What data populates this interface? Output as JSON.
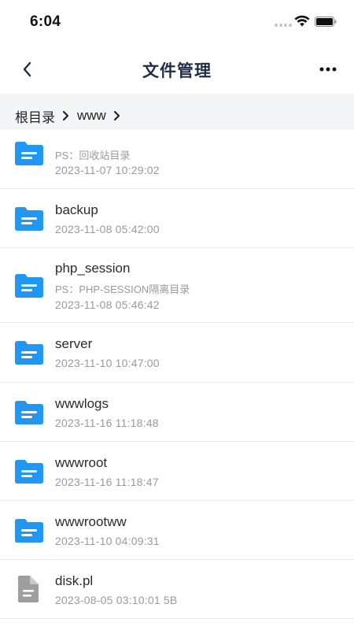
{
  "status_bar": {
    "time": "6:04"
  },
  "nav": {
    "title": "文件管理"
  },
  "breadcrumb": [
    {
      "label": "根目录"
    },
    {
      "label": "www"
    }
  ],
  "files": [
    {
      "name": "",
      "ps": "PS：回收站目录",
      "meta": "2023-11-07 10:29:02",
      "icon": "folder-icon"
    },
    {
      "name": "backup",
      "ps": "",
      "meta": "2023-11-08 05:42:00",
      "icon": "folder-icon"
    },
    {
      "name": "php_session",
      "ps": "PS：PHP-SESSION隔离目录",
      "meta": "2023-11-08 05:46:42",
      "icon": "folder-icon"
    },
    {
      "name": "server",
      "ps": "",
      "meta": "2023-11-10 10:47:00",
      "icon": "folder-icon"
    },
    {
      "name": "wwwlogs",
      "ps": "",
      "meta": "2023-11-16 11:18:48",
      "icon": "folder-icon"
    },
    {
      "name": "wwwroot",
      "ps": "",
      "meta": "2023-11-16 11:18:47",
      "icon": "folder-icon"
    },
    {
      "name": "wwwrootww",
      "ps": "",
      "meta": "2023-11-10 04:09:31",
      "icon": "folder-icon"
    },
    {
      "name": "disk.pl",
      "ps": "",
      "meta": "2023-08-05 03:10:01 5B",
      "icon": "file-icon"
    }
  ],
  "colors": {
    "folder": "#2196f3",
    "file": "#9e9e9e",
    "title": "#1f2d45",
    "breadcrumb_bg": "#f4f5f7"
  }
}
